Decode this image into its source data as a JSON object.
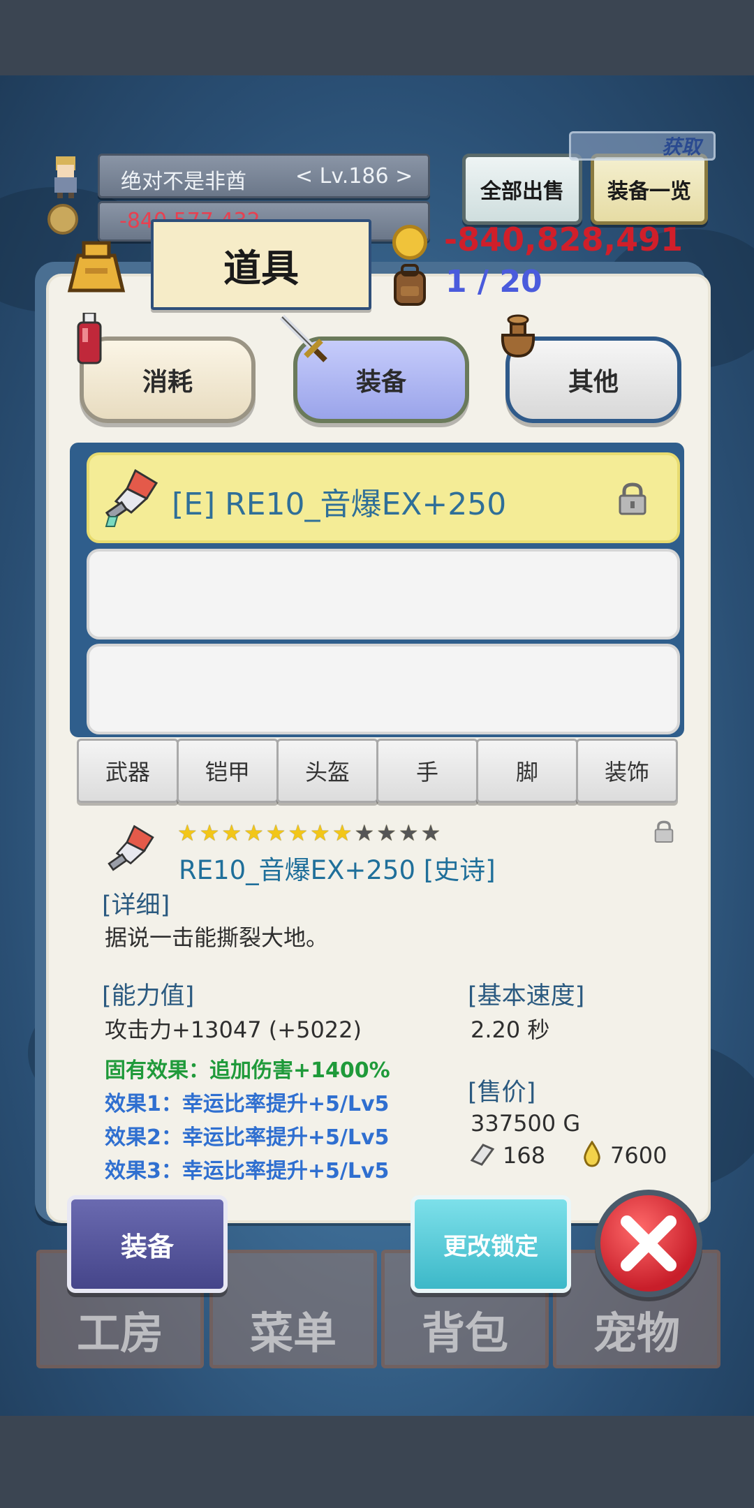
{
  "header": {
    "player_name": "绝对不是非酋",
    "player_level": "< Lv.186 >",
    "gold_small": "-840,577,432",
    "sell_all_label": "全部出售",
    "equipment_list_label": "装备一览",
    "obtain_label": "获取",
    "gold": "-840,828,491",
    "bag_capacity": "1 / 20"
  },
  "panel": {
    "title": "道具",
    "tabs": [
      {
        "label": "消耗"
      },
      {
        "label": "装备"
      },
      {
        "label": "其他"
      }
    ],
    "selected_tab": "装备",
    "items": [
      {
        "name": "[E] RE10_音爆EX+250",
        "locked": true
      },
      {
        "name": ""
      },
      {
        "name": ""
      }
    ],
    "subtabs": [
      "武器",
      "铠甲",
      "头盔",
      "手",
      "脚",
      "装饰"
    ]
  },
  "detail": {
    "stars_filled": 8,
    "stars_total": 12,
    "item_title": "RE10_音爆EX+250 [史诗]",
    "detail_header": "[详细]",
    "description": "据说一击能撕裂大地。",
    "stats_header": "[能力值]",
    "attack": "攻击力+13047 (+5022)",
    "inherent_effect": "固有效果：追加伤害+1400%",
    "effects": [
      "效果1：幸运比率提升+5/Lv5",
      "效果2：幸运比率提升+5/Lv5",
      "效果3：幸运比率提升+5/Lv5"
    ],
    "speed_header": "[基本速度]",
    "speed": "2.20 秒",
    "price_header": "[售价]",
    "price": "337500 G",
    "material_1": "168",
    "material_2": "7600"
  },
  "actions": {
    "equip_label": "装备",
    "change_lock_label": "更改锁定"
  },
  "bottom_nav": [
    {
      "label": "工房"
    },
    {
      "label": "菜单"
    },
    {
      "label": "背包"
    },
    {
      "label": "宠物"
    }
  ],
  "colors": {
    "gold_text": "#d01f2a",
    "bag_text": "#4a5bdc",
    "inherent": "#1f9a3a",
    "effect": "#2f6fd0",
    "selected_tab": "#a8b2f0"
  }
}
